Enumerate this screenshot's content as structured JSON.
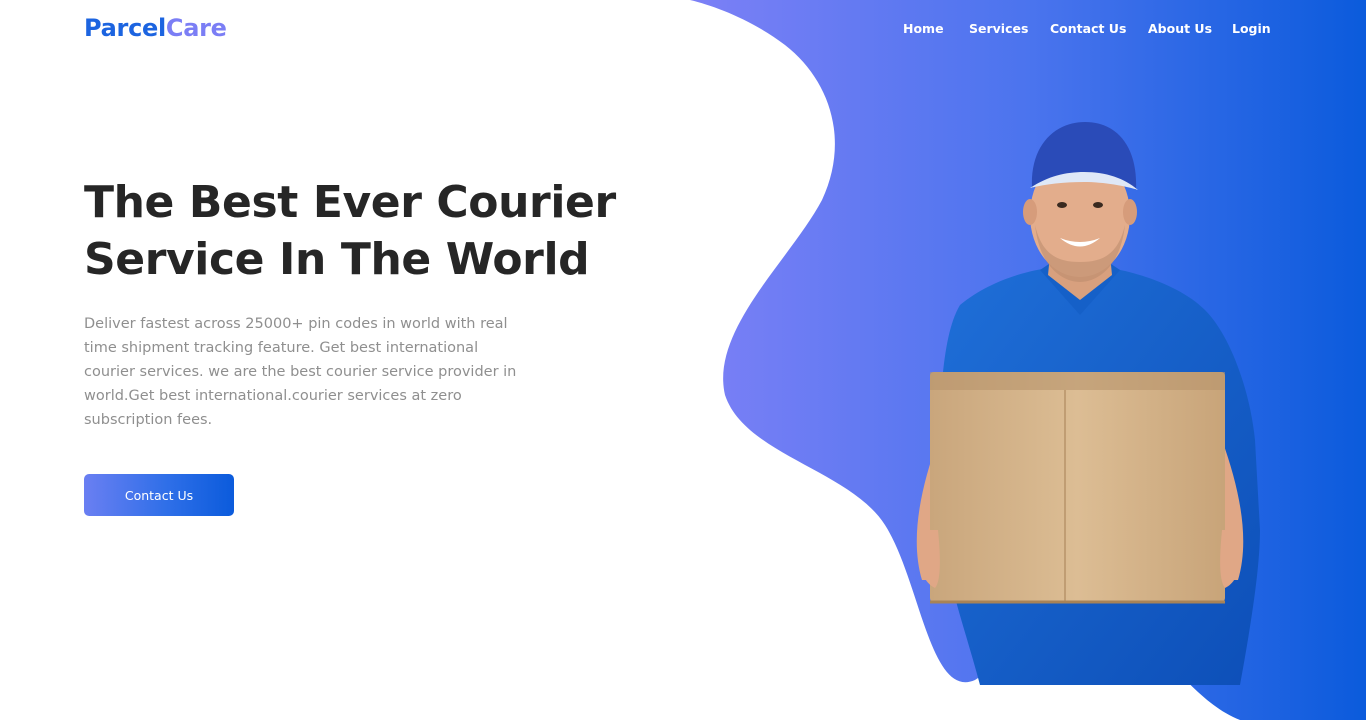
{
  "brand": {
    "part1": "Parcel",
    "part2": "Care"
  },
  "nav": {
    "items": [
      "Home",
      "Services",
      "Contact Us",
      "About Us",
      "Login"
    ]
  },
  "hero": {
    "title_line1": "The Best Ever Courier",
    "title_line2": "Service In The World",
    "description": "Deliver fastest across 25000+ pin codes in world with real time shipment tracking feature. Get best international courier services. we are the best courier service provider in world.Get best international.courier services at zero subscription fees.",
    "cta_label": "Contact Us"
  },
  "theme": {
    "accent": "#1c64e0",
    "accent_light": "#7b7ef5",
    "gradient_start": "#7b7ef5",
    "gradient_end": "#0b5bdc",
    "title_color": "#262626",
    "text_muted": "#8f8f8f"
  },
  "illustration": {
    "icon": "courier-with-box-illustration"
  }
}
